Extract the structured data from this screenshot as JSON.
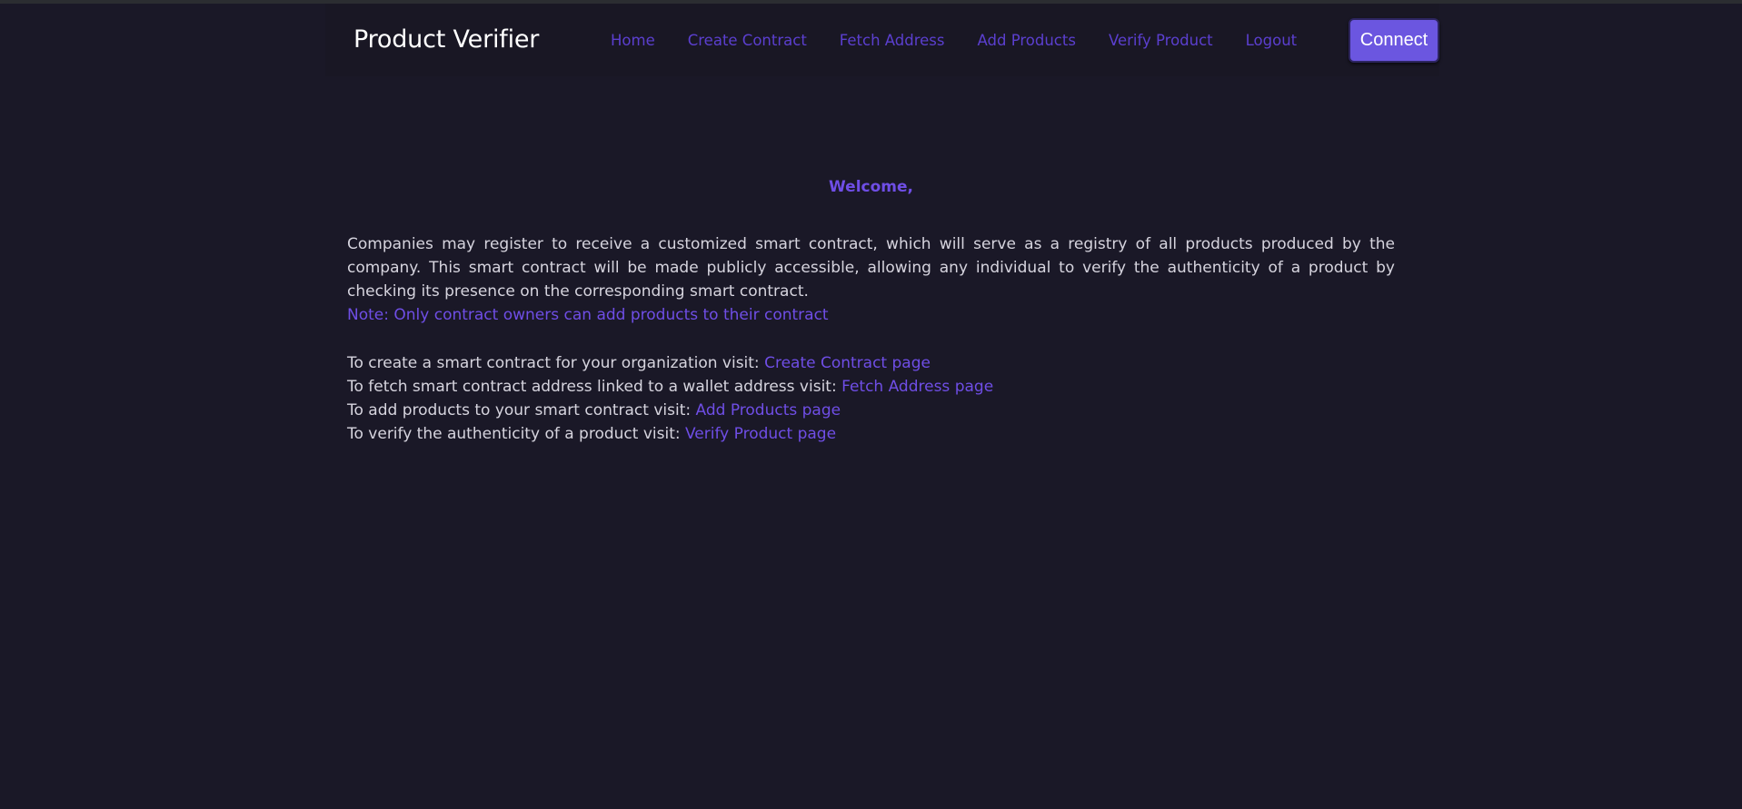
{
  "navbar": {
    "brand": "Product Verifier",
    "links": [
      {
        "label": "Home"
      },
      {
        "label": "Create Contract"
      },
      {
        "label": "Fetch Address"
      },
      {
        "label": "Add Products"
      },
      {
        "label": "Verify Product"
      },
      {
        "label": "Logout"
      }
    ],
    "connect_label": "Connect"
  },
  "main": {
    "welcome": "Welcome,",
    "intro": "Companies may register to receive a customized smart contract, which will serve as a registry of all products produced by the company. This smart contract will be made publicly accessible, allowing any individual to verify the authenticity of a product by checking its presence on the corresponding smart contract.",
    "note": "Note: Only contract owners can add products to their contract",
    "instructions": [
      {
        "text": "To create a smart contract for your organization visit: ",
        "link": "Create Contract page"
      },
      {
        "text": "To fetch smart contract address linked to a wallet address visit: ",
        "link": "Fetch Address page"
      },
      {
        "text": "To add products to your smart contract visit: ",
        "link": "Add Products page"
      },
      {
        "text": "To verify the authenticity of a product visit: ",
        "link": "Verify Product page"
      }
    ]
  },
  "colors": {
    "background": "#1a1827",
    "navbar": "#191724",
    "accent": "#6f4ee6",
    "nav_link": "#5b3fcf",
    "button": "#6b56e0",
    "text": "#d6d4de"
  }
}
